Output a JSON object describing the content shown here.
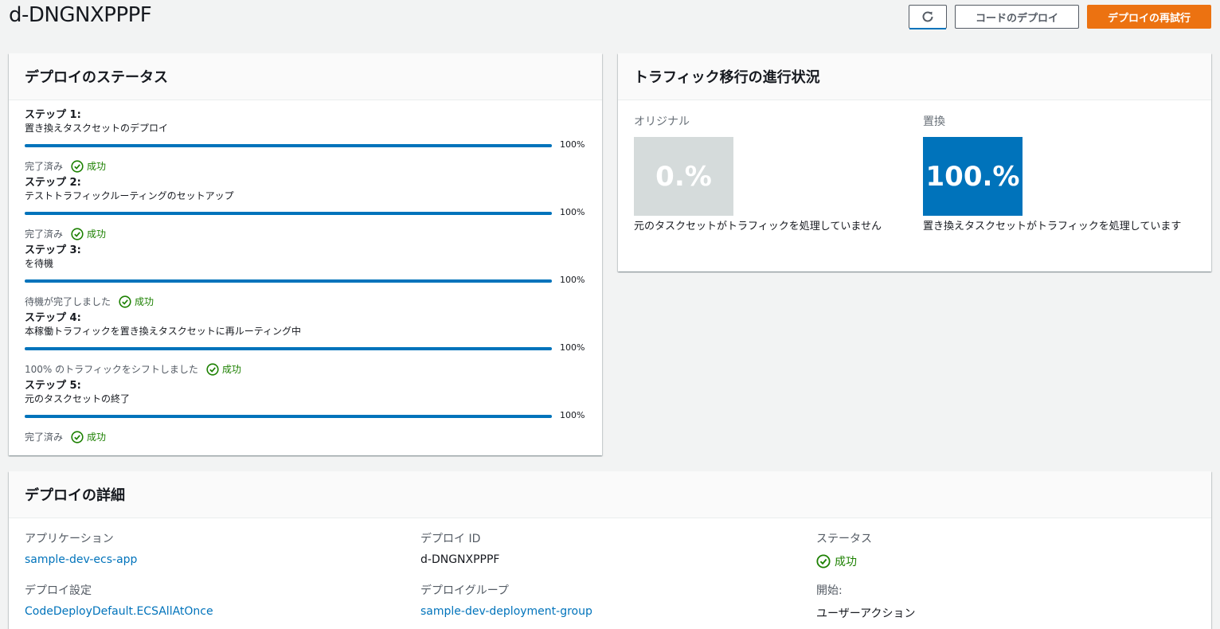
{
  "header": {
    "title": "d-DNGNXPPPF",
    "refresh_icon": "refresh-icon",
    "deploy_code_label": "コードのデプロイ",
    "retry_label": "デプロイの再試行"
  },
  "colors": {
    "accent": "#0073bb",
    "primary_button": "#ec7211",
    "success": "#1d8102",
    "original_box": "#d5dbdb",
    "replacement_box": "#0073bb"
  },
  "status": {
    "title": "デプロイのステータス",
    "steps": [
      {
        "title": "ステップ 1:",
        "desc": "置き換えタスクセットのデプロイ",
        "progress": 100,
        "percent_label": "100%",
        "result": "完了済み",
        "state": "成功"
      },
      {
        "title": "ステップ 2:",
        "desc": "テストトラフィックルーティングのセットアップ",
        "progress": 100,
        "percent_label": "100%",
        "result": "完了済み",
        "state": "成功"
      },
      {
        "title": "ステップ 3:",
        "desc": "を待機",
        "progress": 100,
        "percent_label": "100%",
        "result": "待機が完了しました",
        "state": "成功"
      },
      {
        "title": "ステップ 4:",
        "desc": "本稼働トラフィックを置き換えタスクセットに再ルーティング中",
        "progress": 100,
        "percent_label": "100%",
        "result": "100% のトラフィックをシフトしました",
        "state": "成功"
      },
      {
        "title": "ステップ 5:",
        "desc": "元のタスクセットの終了",
        "progress": 100,
        "percent_label": "100%",
        "result": "完了済み",
        "state": "成功"
      }
    ]
  },
  "traffic": {
    "title": "トラフィック移行の進行状況",
    "original": {
      "label": "オリジナル",
      "percent": "0.%",
      "text": "元のタスクセットがトラフィックを処理していません"
    },
    "replacement": {
      "label": "置換",
      "percent": "100.%",
      "text": "置き換えタスクセットがトラフィックを処理しています"
    }
  },
  "details": {
    "title": "デプロイの詳細",
    "application_label": "アプリケーション",
    "application_value": "sample-dev-ecs-app",
    "deploy_id_label": "デプロイ ID",
    "deploy_id_value": "d-DNGNXPPPF",
    "status_label": "ステータス",
    "status_value": "成功",
    "config_label": "デプロイ設定",
    "config_value": "CodeDeployDefault.ECSAllAtOnce",
    "group_label": "デプロイグループ",
    "group_value": "sample-dev-deployment-group",
    "start_label": "開始:",
    "start_value": "ユーザーアクション"
  }
}
